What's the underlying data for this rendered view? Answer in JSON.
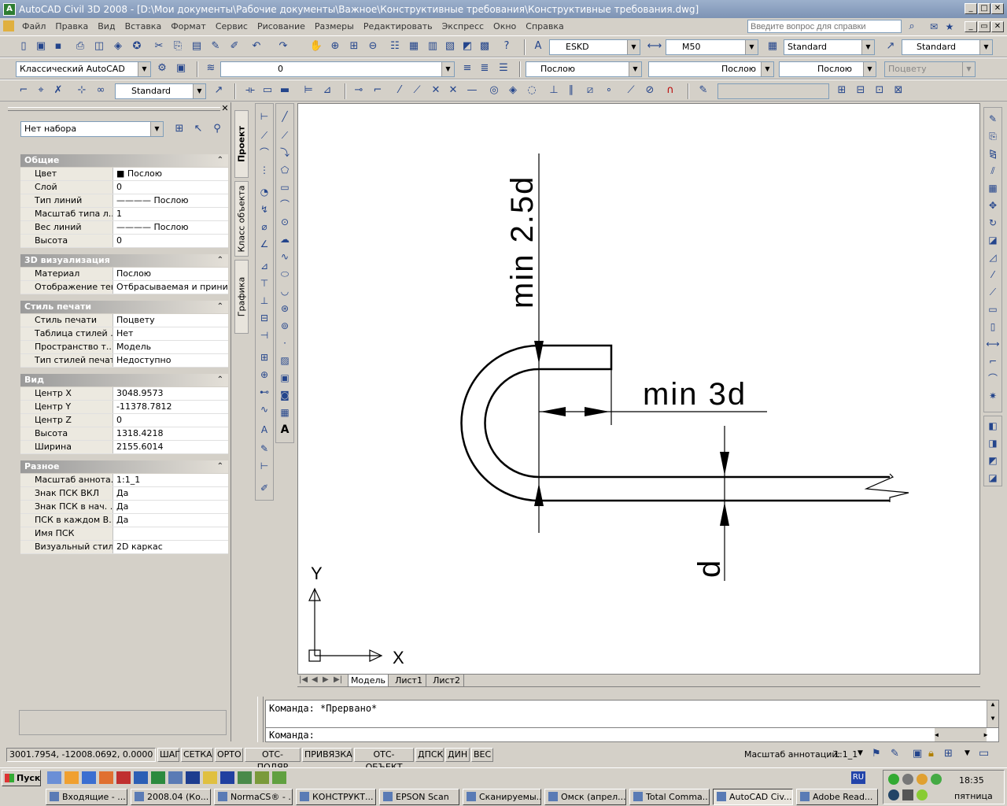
{
  "title": "AutoCAD Civil 3D 2008 - [D:\\Мои документы\\Рабочие документы\\Важное\\Конструктивные требования\\Конструктивные требования.dwg]",
  "menu": [
    "Файл",
    "Правка",
    "Вид",
    "Вставка",
    "Формат",
    "Сервис",
    "Рисование",
    "Размеры",
    "Редактировать",
    "Экспресс",
    "Окно",
    "Справка"
  ],
  "help_placeholder": "Введите вопрос для справки",
  "styles": {
    "text": "ESKD",
    "dim": "M50",
    "table": "Standard",
    "mleader": "Standard"
  },
  "workspace": "Классический AutoCAD",
  "layer": "0",
  "color": "Послою",
  "linetype": "Послою",
  "lineweight": "Послою",
  "plotstyle": "Поцвету",
  "ucs_style": "Standard",
  "props": {
    "selection": "Нет набора",
    "sections": [
      {
        "title": "Общие",
        "rows": [
          [
            "Цвет",
            "■ Послою"
          ],
          [
            "Слой",
            "0"
          ],
          [
            "Тип линий",
            "———— Послою"
          ],
          [
            "Масштаб типа л...",
            "1"
          ],
          [
            "Вес линий",
            "———— Послою"
          ],
          [
            "Высота",
            "0"
          ]
        ]
      },
      {
        "title": "3D визуализация",
        "rows": [
          [
            "Материал",
            "Послою"
          ],
          [
            "Отображение тени",
            "Отбрасываемая и приним..."
          ]
        ]
      },
      {
        "title": "Стиль печати",
        "rows": [
          [
            "Стиль печати",
            "Поцвету"
          ],
          [
            "Таблица стилей ...",
            "Нет"
          ],
          [
            "Пространство т...",
            "Модель"
          ],
          [
            "Тип стилей печати",
            "Недоступно"
          ]
        ]
      },
      {
        "title": "Вид",
        "rows": [
          [
            "Центр X",
            "3048.9573"
          ],
          [
            "Центр Y",
            "-11378.7812"
          ],
          [
            "Центр Z",
            "0"
          ],
          [
            "Высота",
            "1318.4218"
          ],
          [
            "Ширина",
            "2155.6014"
          ]
        ]
      },
      {
        "title": "Разное",
        "rows": [
          [
            "Масштаб аннота...",
            "1:1_1"
          ],
          [
            "Знак ПСК ВКЛ",
            "Да"
          ],
          [
            "Знак ПСК в нач. ...",
            "Да"
          ],
          [
            "ПСК в каждом В...",
            "Да"
          ],
          [
            "Имя ПСК",
            ""
          ],
          [
            "Визуальный стиль",
            "2D каркас"
          ]
        ]
      }
    ]
  },
  "vtabs": [
    "Проект",
    "Класс объекта",
    "Графика"
  ],
  "drawing": {
    "label1": "min  2.5d",
    "label2": "min  3d",
    "label3": "d",
    "axis_x": "X",
    "axis_y": "Y"
  },
  "layout_tabs": [
    "Модель",
    "Лист1",
    "Лист2"
  ],
  "command": {
    "history": "Команда: *Прервано*",
    "prompt": "Команда:"
  },
  "status": {
    "coords": "3001.7954, -12008.0692, 0.0000",
    "toggles": [
      "ШАГ",
      "СЕТКА",
      "ОРТО",
      "ОТС-ПОЛЯР",
      "ПРИВЯЗКА",
      "ОТС-ОБЪЕКТ",
      "ДПСК",
      "ДИН",
      "ВЕС"
    ],
    "annot_label": "Масштаб аннотаций:",
    "annot_value": "1:1_1"
  },
  "taskbar": {
    "start": "Пуск",
    "lang": "RU",
    "time": "18:35",
    "day": "пятница",
    "tasks": [
      "Входящие - ...",
      "2008.04 (Ко...",
      "NormaCS® - ...",
      "КОНСТРУКТ...",
      "EPSON Scan",
      "Сканируемы...",
      "Омск (апрел...",
      "Total Comma...",
      "AutoCAD Civ...",
      "Adobe Read..."
    ]
  }
}
